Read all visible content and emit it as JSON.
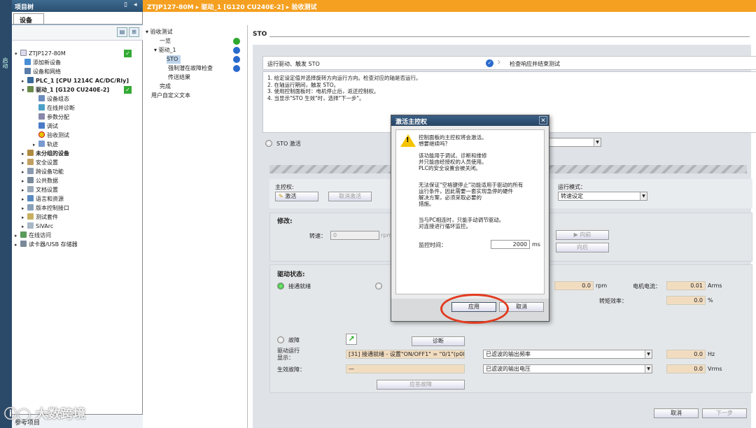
{
  "window": {
    "top_bar": "ZTJP127-80M ▸ 驱动_1 [G120 CU240E-2] ▸ 验收测试"
  },
  "left_strip": {
    "label": "启动"
  },
  "project_tree": {
    "title": "项目树",
    "tab": "设备",
    "items": [
      {
        "label": "ZTJP127-80M",
        "check": true
      },
      {
        "label": "添加新设备"
      },
      {
        "label": "设备和网络"
      },
      {
        "label": "PLC_1 [CPU 1214C AC/DC/Rly]"
      },
      {
        "label": "驱动_1 [G120 CU240E-2]",
        "check": true
      },
      {
        "label": "设备组态"
      },
      {
        "label": "在线并诊断"
      },
      {
        "label": "参数分配"
      },
      {
        "label": "调试"
      },
      {
        "label": "验收测试"
      },
      {
        "label": "轨迹"
      },
      {
        "label": "未分组的设备"
      },
      {
        "label": "安全设置"
      },
      {
        "label": "跨设备功能"
      },
      {
        "label": "公共数据"
      },
      {
        "label": "文档设置"
      },
      {
        "label": "语言和资源"
      },
      {
        "label": "版本控制接口"
      },
      {
        "label": "测试套件"
      },
      {
        "label": "SiVArc"
      },
      {
        "label": "在线访问"
      },
      {
        "label": "读卡器/USB 存储器"
      }
    ],
    "reference": "参考项目"
  },
  "steps": {
    "items": [
      {
        "label": "验收测试"
      },
      {
        "label": "一览"
      },
      {
        "label": "驱动_1"
      },
      {
        "label": "STO"
      },
      {
        "label": "强制潜在故障检查"
      },
      {
        "label": "传送结果"
      },
      {
        "label": "完成"
      },
      {
        "label": "用户自定义文本"
      }
    ]
  },
  "main": {
    "section": "STO",
    "step_current": "运行驱动、触发 STO",
    "step_next": "检查响应并结束测试",
    "instructions": [
      "1. 给定设定值并选择旋转方向运行方向。检查对应的轴是否运行。",
      "2. 在轴运行期间，触发 STO。",
      "3. 使用控制面板时：电机停止后，返还控制权。",
      "4. 当显示\"STO 生效\"时，选择\"下一步\"。"
    ],
    "sto_active": "STO 激活",
    "master_control": "主控权:",
    "activate": "激活",
    "cancel_activate": "取消激活",
    "run_mode_label": "运行模式：",
    "run_mode_value": "转速设定",
    "modify": "修改:",
    "speed_label": "转速：",
    "speed_value": "0",
    "speed_unit": "rpm",
    "forward": "向前",
    "backward": "向后",
    "drive_status": "驱动状态:",
    "ready": "接通就绪",
    "actual_speed": "0.0",
    "actual_speed_unit": "rpm",
    "motor_current_label": "电机电流：",
    "motor_current": "0.01",
    "motor_current_unit": "Arms",
    "torque_eff_label": "转矩效率：",
    "torque_eff": "0.0",
    "torque_eff_unit": "%",
    "fault": "故障",
    "diagnose": "诊断",
    "drive_run_label": "驱动运行\n显示：",
    "drive_run_value": "[31] 接通就绪 - 设置\"ON/OFF1\" = \"0/1\"(p0840",
    "active_fault_label": "生效故障：",
    "active_fault_value": "—",
    "ack_fault": "应答故障",
    "out_freq": "已滤波的输出频率",
    "out_freq_val": "0.0",
    "out_freq_unit": "Hz",
    "out_volt": "已滤波的输出电压",
    "out_volt_val": "0.0",
    "out_volt_unit": "Vrms",
    "cancel": "取消",
    "next": "下一步"
  },
  "dialog": {
    "title": "激活主控权",
    "close": "✕",
    "lines": [
      "控制面板的主控权将会激活。",
      "想要继续吗？",
      "",
      "该功能用于调试、诊断和维修",
      "并只能由经授权的人员使用。",
      "PLC的安全设置会被关闭。",
      "",
      "无法保证\"空格键停止\"功能适用于驱动的所有",
      "运行条件，因此需要一套实现急停的硬件",
      "解决方案，必须采取必要的",
      "措施。",
      "",
      "当与PC相连时，只能手动调节驱动。",
      "对连接进行循环监控。"
    ],
    "monitor_label": "监控时间：",
    "monitor_value": "2000",
    "monitor_unit": "ms",
    "apply": "应用",
    "cancel": "取消"
  },
  "watermark": "ⓘ◯ 大数跨境"
}
